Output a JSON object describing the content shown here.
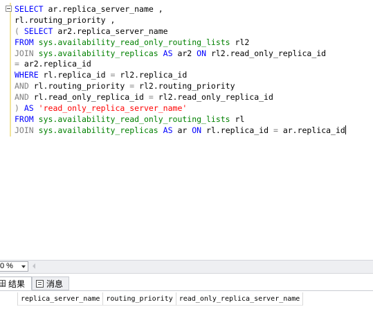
{
  "editor": {
    "lines": [
      [
        {
          "t": "SELECT",
          "c": "kw"
        },
        {
          "t": " ar.replica_server_name ,",
          "c": ""
        }
      ],
      [
        {
          "t": "rl.routing_priority ,",
          "c": ""
        }
      ],
      [
        {
          "t": "( ",
          "c": "gray"
        },
        {
          "t": "SELECT",
          "c": "kw"
        },
        {
          "t": " ar2.replica_server_name",
          "c": ""
        }
      ],
      [
        {
          "t": "FROM",
          "c": "kw"
        },
        {
          "t": " ",
          "c": ""
        },
        {
          "t": "sys.availability_read_only_routing_lists",
          "c": "obj"
        },
        {
          "t": " rl2",
          "c": ""
        }
      ],
      [
        {
          "t": "JOIN",
          "c": "gray"
        },
        {
          "t": " ",
          "c": ""
        },
        {
          "t": "sys.availability_replicas",
          "c": "obj"
        },
        {
          "t": " ",
          "c": ""
        },
        {
          "t": "AS",
          "c": "kw"
        },
        {
          "t": " ar2 ",
          "c": ""
        },
        {
          "t": "ON",
          "c": "kw"
        },
        {
          "t": " rl2.read_only_replica_id",
          "c": ""
        }
      ],
      [
        {
          "t": "=",
          "c": "gray"
        },
        {
          "t": " ar2.replica_id",
          "c": ""
        }
      ],
      [
        {
          "t": "WHERE",
          "c": "kw"
        },
        {
          "t": " rl.replica_id ",
          "c": ""
        },
        {
          "t": "=",
          "c": "gray"
        },
        {
          "t": " rl2.replica_id",
          "c": ""
        }
      ],
      [
        {
          "t": "AND",
          "c": "gray"
        },
        {
          "t": " rl.routing_priority ",
          "c": ""
        },
        {
          "t": "=",
          "c": "gray"
        },
        {
          "t": " rl2.routing_priority",
          "c": ""
        }
      ],
      [
        {
          "t": "AND",
          "c": "gray"
        },
        {
          "t": " rl.read_only_replica_id ",
          "c": ""
        },
        {
          "t": "=",
          "c": "gray"
        },
        {
          "t": " rl2.read_only_replica_id",
          "c": ""
        }
      ],
      [
        {
          "t": ")",
          "c": "gray"
        },
        {
          "t": " ",
          "c": ""
        },
        {
          "t": "AS",
          "c": "kw"
        },
        {
          "t": " ",
          "c": ""
        },
        {
          "t": "'read_only_replica_server_name'",
          "c": "str"
        }
      ],
      [
        {
          "t": "FROM",
          "c": "kw"
        },
        {
          "t": " ",
          "c": ""
        },
        {
          "t": "sys.availability_read_only_routing_lists",
          "c": "obj"
        },
        {
          "t": " rl",
          "c": ""
        }
      ],
      [
        {
          "t": "JOIN",
          "c": "gray"
        },
        {
          "t": " ",
          "c": ""
        },
        {
          "t": "sys.availability_replicas",
          "c": "obj"
        },
        {
          "t": " ",
          "c": ""
        },
        {
          "t": "AS",
          "c": "kw"
        },
        {
          "t": " ar ",
          "c": ""
        },
        {
          "t": "ON",
          "c": "kw"
        },
        {
          "t": " rl.replica_id ",
          "c": ""
        },
        {
          "t": "=",
          "c": "gray"
        },
        {
          "t": " ar.replica_id",
          "c": ""
        }
      ]
    ]
  },
  "zoom": {
    "value": "0 %"
  },
  "tabs": {
    "results_label": "结果",
    "messages_label": "消息"
  },
  "results_grid": {
    "columns": [
      "replica_server_name",
      "routing_priority",
      "read_only_replica_server_name"
    ]
  },
  "colors": {
    "keyword": "#0000ff",
    "object": "#008000",
    "operator": "#808080",
    "string": "#ff0000"
  },
  "icons": {
    "results_tab": "grid-icon",
    "messages_tab": "message-icon",
    "zoom_dropdown": "chevron-down-icon",
    "scroll_left": "scroll-left-arrow-icon"
  }
}
